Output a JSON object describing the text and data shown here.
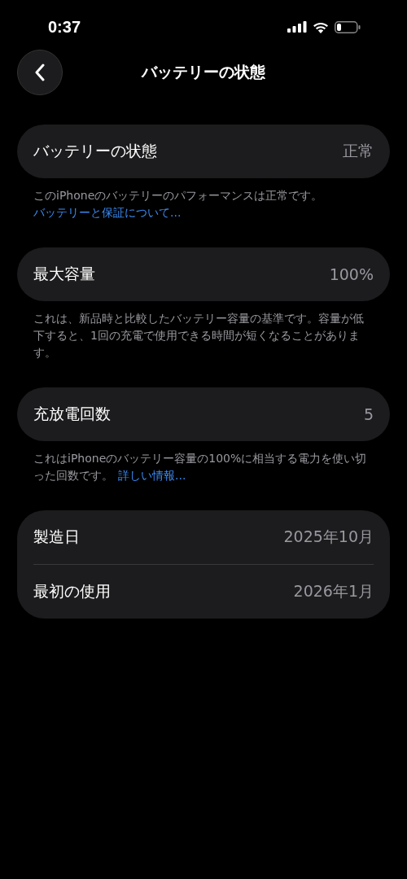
{
  "status_bar": {
    "time": "0:37"
  },
  "nav": {
    "title": "バッテリーの状態"
  },
  "sections": [
    {
      "rows": [
        {
          "label": "バッテリーの状態",
          "value": "正常"
        }
      ],
      "footer": {
        "text": "このiPhoneのバッテリーのパフォーマンスは正常です。",
        "link": "バッテリーと保証について...",
        "link_newline": true
      }
    },
    {
      "rows": [
        {
          "label": "最大容量",
          "value": "100%"
        }
      ],
      "footer": {
        "text": "これは、新品時と比較したバッテリー容量の基準です。容量が低下すると、1回の充電で使用できる時間が短くなることがあります。"
      }
    },
    {
      "rows": [
        {
          "label": "充放電回数",
          "value": "5"
        }
      ],
      "footer": {
        "text": "これはiPhoneのバッテリー容量の100%に相当する電力を使い切った回数です。",
        "link": "詳しい情報...",
        "link_newline": false
      }
    },
    {
      "rows": [
        {
          "label": "製造日",
          "value": "2025年10月"
        },
        {
          "label": "最初の使用",
          "value": "2026年1月"
        }
      ]
    }
  ]
}
